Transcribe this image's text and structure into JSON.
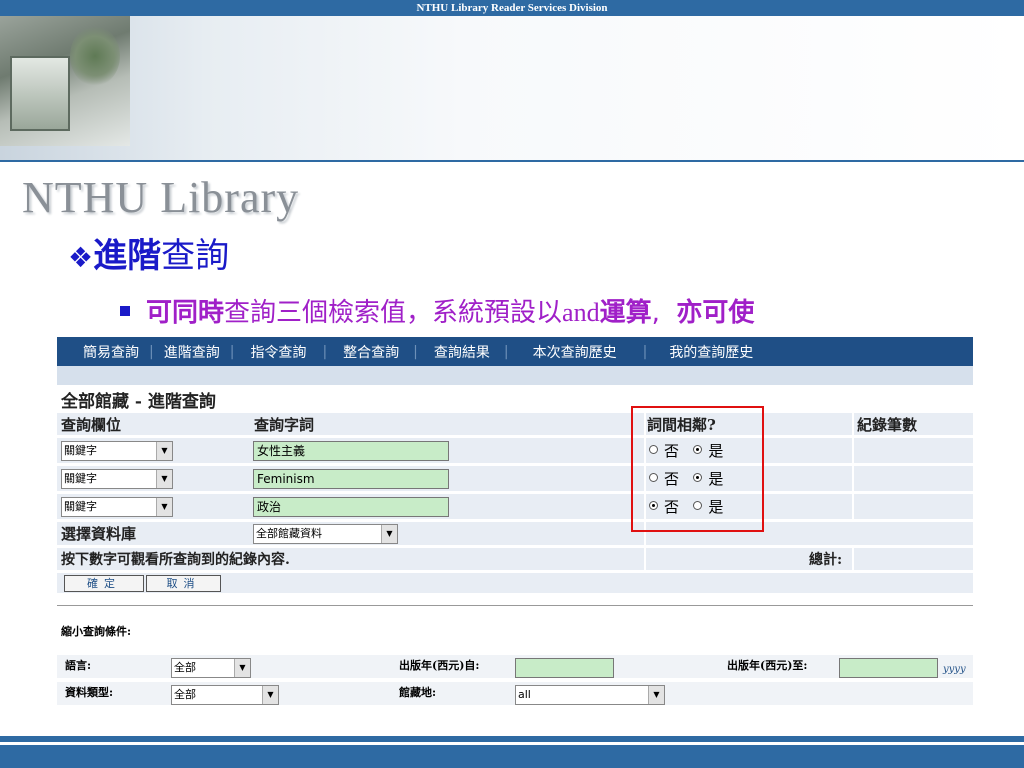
{
  "window": {
    "title": "NTHU Library Reader Services Division"
  },
  "logo": "NTHU Library",
  "slide": {
    "heading_bold": "進階",
    "heading_rest": "查詢",
    "bullet_bold": "可同時",
    "bullet_mid": "查詢三個檢索值，系統預設以",
    "bullet_en": "and",
    "bullet_bold2": "運算",
    "bullet_sep": ",",
    "bullet_end": "亦可使"
  },
  "nav": [
    "簡易查詢",
    "進階查詢",
    "指令查詢",
    "整合查詢",
    "查詢結果",
    "本次查詢歷史",
    "我的查詢歷史"
  ],
  "form": {
    "title": "全部館藏 - 進階查詢",
    "col_field": "查詢欄位",
    "col_term": "查詢字詞",
    "col_adjacent": "詞間相鄰?",
    "col_count": "紀錄筆數",
    "rows": [
      {
        "field": "關鍵字",
        "term": "女性主義",
        "no": "否",
        "yes": "是",
        "selected": "yes"
      },
      {
        "field": "關鍵字",
        "term": "Feminism",
        "no": "否",
        "yes": "是",
        "selected": "yes"
      },
      {
        "field": "關鍵字",
        "term": "政治",
        "no": "否",
        "yes": "是",
        "selected": "no"
      }
    ],
    "db_label": "選擇資料庫",
    "db_value": "全部館藏資料",
    "hint": "按下數字可觀看所查詢到的紀錄內容.",
    "total_label": "總計:",
    "ok_button": "確定",
    "cancel_button": "取消"
  },
  "filters": {
    "heading": "縮小查詢條件:",
    "language_label": "語言:",
    "language_value": "全部",
    "year_from_label": "出版年(西元)自:",
    "year_to_label": "出版年(西元)至:",
    "year_hint": "yyyy",
    "type_label": "資料類型:",
    "type_value": "全部",
    "location_label": "館藏地:",
    "location_value": "all"
  },
  "colors": {
    "nav_bg": "#1f4f86",
    "highlight_box": "#e01010",
    "input_bg": "#c8ecc8",
    "heading_blue": "#1a1ac8",
    "bullet_purple": "#a020c8"
  }
}
